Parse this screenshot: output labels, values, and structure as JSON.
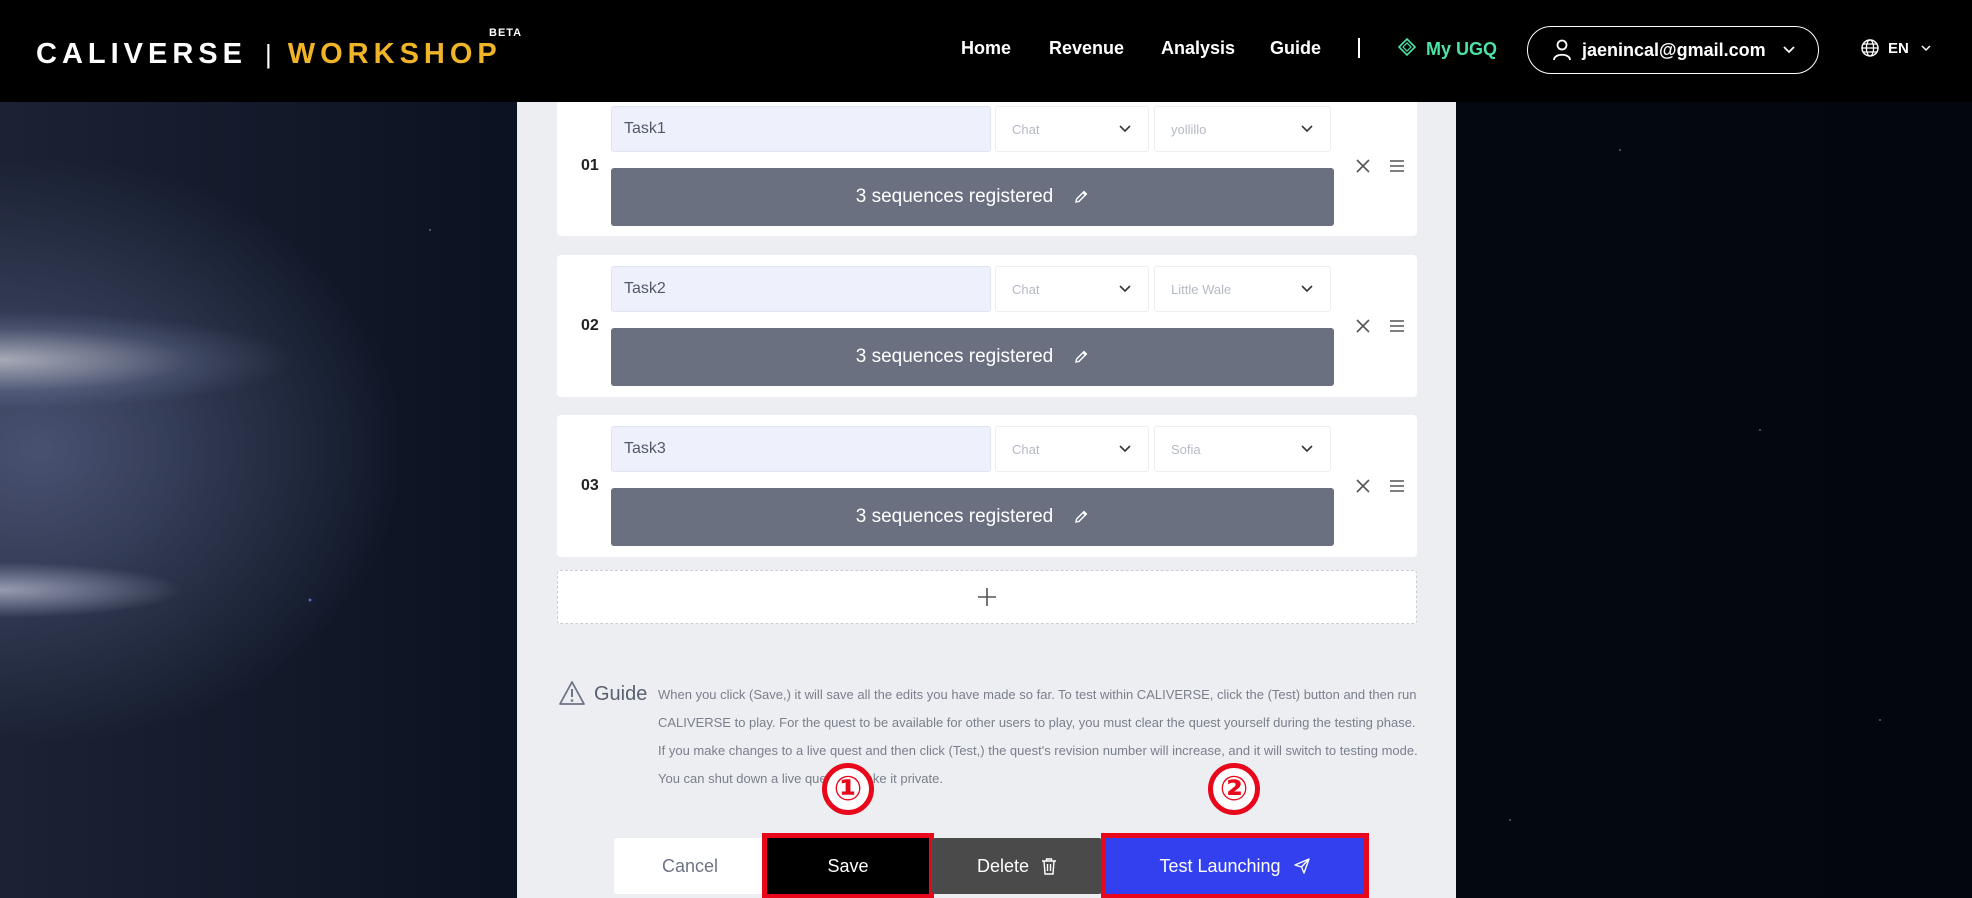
{
  "header": {
    "logo": {
      "primary": "CALIVERSE",
      "separator": "|",
      "secondary": "WORKSHOP",
      "tag": "BETA"
    },
    "nav": [
      "Home",
      "Revenue",
      "Analysis",
      "Guide"
    ],
    "my_ugq": "My UGQ",
    "account_email": "jaenincal@gmail.com",
    "language": "EN"
  },
  "tasks": [
    {
      "number": "01",
      "name": "Task1",
      "type": "Chat",
      "npc": "yollillo",
      "sequences_label": "3 sequences registered"
    },
    {
      "number": "02",
      "name": "Task2",
      "type": "Chat",
      "npc": "Little Wale",
      "sequences_label": "3 sequences registered"
    },
    {
      "number": "03",
      "name": "Task3",
      "type": "Chat",
      "npc": "Sofia",
      "sequences_label": "3 sequences registered"
    }
  ],
  "guide": {
    "title": "Guide",
    "text": "When you click (Save,) it will save all the edits you have made so far. To test within CALIVERSE, click the (Test) button and then run CALIVERSE to play. For the quest to be available for other users to play, you must clear the quest yourself during the testing phase. If you make changes to a live quest and then click (Test,) the quest's revision number will increase, and it will switch to testing mode. You can shut down a live quest to make it private."
  },
  "actions": {
    "cancel": "Cancel",
    "save": "Save",
    "delete": "Delete",
    "test_launching": "Test Launching"
  },
  "annotations": [
    "①",
    "②"
  ],
  "colors": {
    "accent": "#3340f0",
    "highlight": "#e8071b",
    "brand_gold": "#f0b429",
    "ugq_green": "#4be3a6"
  }
}
